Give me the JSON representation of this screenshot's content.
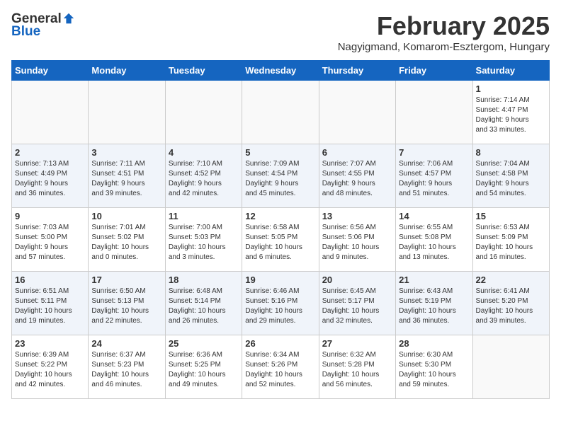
{
  "header": {
    "logo_general": "General",
    "logo_blue": "Blue",
    "title": "February 2025",
    "subtitle": "Nagyigmand, Komarom-Esztergom, Hungary"
  },
  "weekdays": [
    "Sunday",
    "Monday",
    "Tuesday",
    "Wednesday",
    "Thursday",
    "Friday",
    "Saturday"
  ],
  "weeks": [
    [
      {
        "day": "",
        "info": ""
      },
      {
        "day": "",
        "info": ""
      },
      {
        "day": "",
        "info": ""
      },
      {
        "day": "",
        "info": ""
      },
      {
        "day": "",
        "info": ""
      },
      {
        "day": "",
        "info": ""
      },
      {
        "day": "1",
        "info": "Sunrise: 7:14 AM\nSunset: 4:47 PM\nDaylight: 9 hours\nand 33 minutes."
      }
    ],
    [
      {
        "day": "2",
        "info": "Sunrise: 7:13 AM\nSunset: 4:49 PM\nDaylight: 9 hours\nand 36 minutes."
      },
      {
        "day": "3",
        "info": "Sunrise: 7:11 AM\nSunset: 4:51 PM\nDaylight: 9 hours\nand 39 minutes."
      },
      {
        "day": "4",
        "info": "Sunrise: 7:10 AM\nSunset: 4:52 PM\nDaylight: 9 hours\nand 42 minutes."
      },
      {
        "day": "5",
        "info": "Sunrise: 7:09 AM\nSunset: 4:54 PM\nDaylight: 9 hours\nand 45 minutes."
      },
      {
        "day": "6",
        "info": "Sunrise: 7:07 AM\nSunset: 4:55 PM\nDaylight: 9 hours\nand 48 minutes."
      },
      {
        "day": "7",
        "info": "Sunrise: 7:06 AM\nSunset: 4:57 PM\nDaylight: 9 hours\nand 51 minutes."
      },
      {
        "day": "8",
        "info": "Sunrise: 7:04 AM\nSunset: 4:58 PM\nDaylight: 9 hours\nand 54 minutes."
      }
    ],
    [
      {
        "day": "9",
        "info": "Sunrise: 7:03 AM\nSunset: 5:00 PM\nDaylight: 9 hours\nand 57 minutes."
      },
      {
        "day": "10",
        "info": "Sunrise: 7:01 AM\nSunset: 5:02 PM\nDaylight: 10 hours\nand 0 minutes."
      },
      {
        "day": "11",
        "info": "Sunrise: 7:00 AM\nSunset: 5:03 PM\nDaylight: 10 hours\nand 3 minutes."
      },
      {
        "day": "12",
        "info": "Sunrise: 6:58 AM\nSunset: 5:05 PM\nDaylight: 10 hours\nand 6 minutes."
      },
      {
        "day": "13",
        "info": "Sunrise: 6:56 AM\nSunset: 5:06 PM\nDaylight: 10 hours\nand 9 minutes."
      },
      {
        "day": "14",
        "info": "Sunrise: 6:55 AM\nSunset: 5:08 PM\nDaylight: 10 hours\nand 13 minutes."
      },
      {
        "day": "15",
        "info": "Sunrise: 6:53 AM\nSunset: 5:09 PM\nDaylight: 10 hours\nand 16 minutes."
      }
    ],
    [
      {
        "day": "16",
        "info": "Sunrise: 6:51 AM\nSunset: 5:11 PM\nDaylight: 10 hours\nand 19 minutes."
      },
      {
        "day": "17",
        "info": "Sunrise: 6:50 AM\nSunset: 5:13 PM\nDaylight: 10 hours\nand 22 minutes."
      },
      {
        "day": "18",
        "info": "Sunrise: 6:48 AM\nSunset: 5:14 PM\nDaylight: 10 hours\nand 26 minutes."
      },
      {
        "day": "19",
        "info": "Sunrise: 6:46 AM\nSunset: 5:16 PM\nDaylight: 10 hours\nand 29 minutes."
      },
      {
        "day": "20",
        "info": "Sunrise: 6:45 AM\nSunset: 5:17 PM\nDaylight: 10 hours\nand 32 minutes."
      },
      {
        "day": "21",
        "info": "Sunrise: 6:43 AM\nSunset: 5:19 PM\nDaylight: 10 hours\nand 36 minutes."
      },
      {
        "day": "22",
        "info": "Sunrise: 6:41 AM\nSunset: 5:20 PM\nDaylight: 10 hours\nand 39 minutes."
      }
    ],
    [
      {
        "day": "23",
        "info": "Sunrise: 6:39 AM\nSunset: 5:22 PM\nDaylight: 10 hours\nand 42 minutes."
      },
      {
        "day": "24",
        "info": "Sunrise: 6:37 AM\nSunset: 5:23 PM\nDaylight: 10 hours\nand 46 minutes."
      },
      {
        "day": "25",
        "info": "Sunrise: 6:36 AM\nSunset: 5:25 PM\nDaylight: 10 hours\nand 49 minutes."
      },
      {
        "day": "26",
        "info": "Sunrise: 6:34 AM\nSunset: 5:26 PM\nDaylight: 10 hours\nand 52 minutes."
      },
      {
        "day": "27",
        "info": "Sunrise: 6:32 AM\nSunset: 5:28 PM\nDaylight: 10 hours\nand 56 minutes."
      },
      {
        "day": "28",
        "info": "Sunrise: 6:30 AM\nSunset: 5:30 PM\nDaylight: 10 hours\nand 59 minutes."
      },
      {
        "day": "",
        "info": ""
      }
    ]
  ]
}
